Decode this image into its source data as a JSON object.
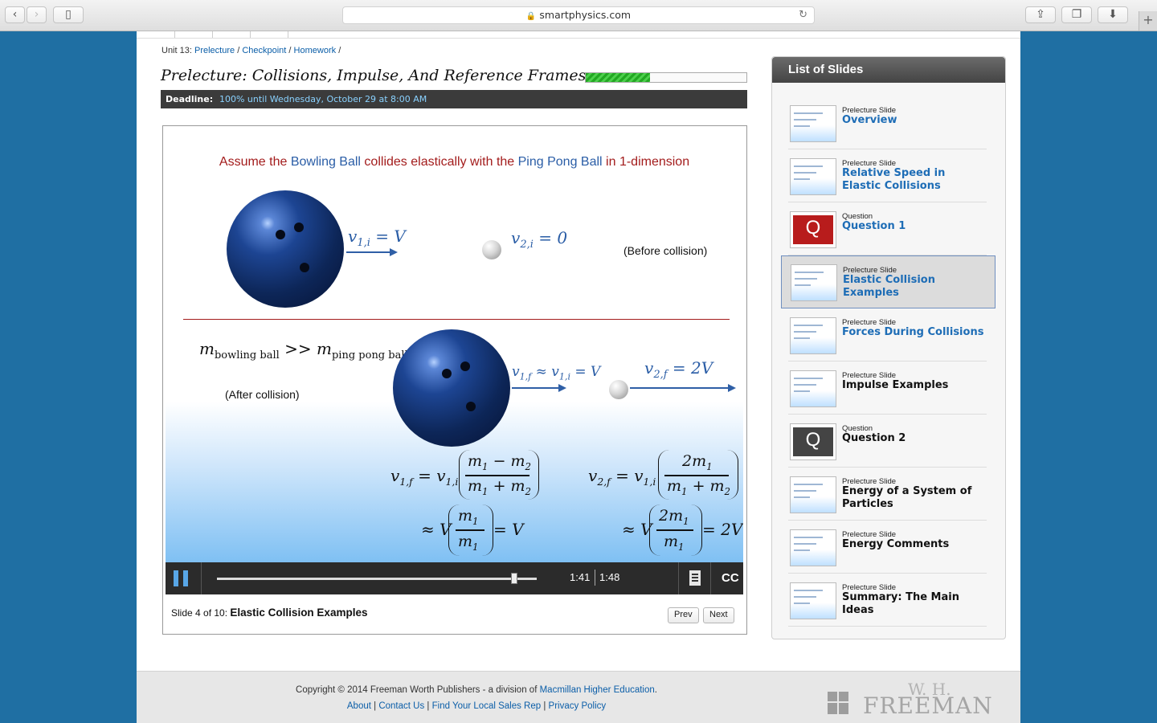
{
  "browser": {
    "url": "smartphysics.com"
  },
  "breadcrumb": {
    "prefix": "Unit 13:",
    "items": [
      "Prelecture",
      "Checkpoint",
      "Homework"
    ],
    "separator": "/"
  },
  "lecture": {
    "title": "Prelecture: Collisions, Impulse, And Reference Frames",
    "progress_fraction": 0.4,
    "deadline_label": "Deadline:",
    "deadline_value": "100% until Wednesday, October 29 at 8:00 AM"
  },
  "slide": {
    "headline_pre": "Assume the ",
    "headline_a": "Bowling Ball",
    "headline_mid": " collides elastically with the ",
    "headline_b": "Ping Pong Ball",
    "headline_post": " in 1-dimension",
    "before_label": "(Before collision)",
    "after_label": "(After collision)",
    "eq_v1i": "= V",
    "eq_v2i": "= 0",
    "eq_v1f": "≈ v",
    "eq_v1f_tail": "= V",
    "eq_v2f": "= 2V",
    "mass_relation": ">>",
    "mass_a": "bowling ball",
    "mass_b": "ping pong ball"
  },
  "player": {
    "time_current": "1:41",
    "time_total": "1:48",
    "seek_fraction": 0.93,
    "cc_label": "CC",
    "caption_prefix": "Slide 4 of 10:",
    "caption_title": "Elastic Collision Examples",
    "prev_label": "Prev",
    "next_label": "Next"
  },
  "slide_list": {
    "title": "List of Slides",
    "items": [
      {
        "type": "Prelecture Slide",
        "name": "Overview",
        "style": "blue"
      },
      {
        "type": "Prelecture Slide",
        "name": "Relative Speed in Elastic Collisions",
        "style": "blue"
      },
      {
        "type": "Question",
        "name": "Question 1",
        "style": "blue",
        "qcolor": "#b81c1c"
      },
      {
        "type": "Prelecture Slide",
        "name": "Elastic Collision Examples",
        "style": "blue",
        "active": true
      },
      {
        "type": "Prelecture Slide",
        "name": "Forces During Collisions",
        "style": "blue"
      },
      {
        "type": "Prelecture Slide",
        "name": "Impulse Examples",
        "style": "dark"
      },
      {
        "type": "Question",
        "name": "Question 2",
        "style": "dark",
        "qcolor": "#444444"
      },
      {
        "type": "Prelecture Slide",
        "name": "Energy of a System of Particles",
        "style": "dark"
      },
      {
        "type": "Prelecture Slide",
        "name": "Energy Comments",
        "style": "dark"
      },
      {
        "type": "Prelecture Slide",
        "name": "Summary: The Main Ideas",
        "style": "dark"
      }
    ]
  },
  "footer": {
    "copyright": "Copyright © 2014 Freeman Worth Publishers - a division of",
    "copyright_link": "Macmillan Higher Education",
    "copyright_end": ".",
    "links": [
      "About",
      "Contact Us",
      "Find Your Local Sales Rep",
      "Privacy Policy"
    ],
    "logo_top": "W. H.",
    "logo_main": "FREEMAN"
  },
  "colors": {
    "link": "#0b5ea8",
    "slide_list_blue": "#1e6db6",
    "headline_red": "#a31c1c",
    "progress_green": "#23a823"
  }
}
